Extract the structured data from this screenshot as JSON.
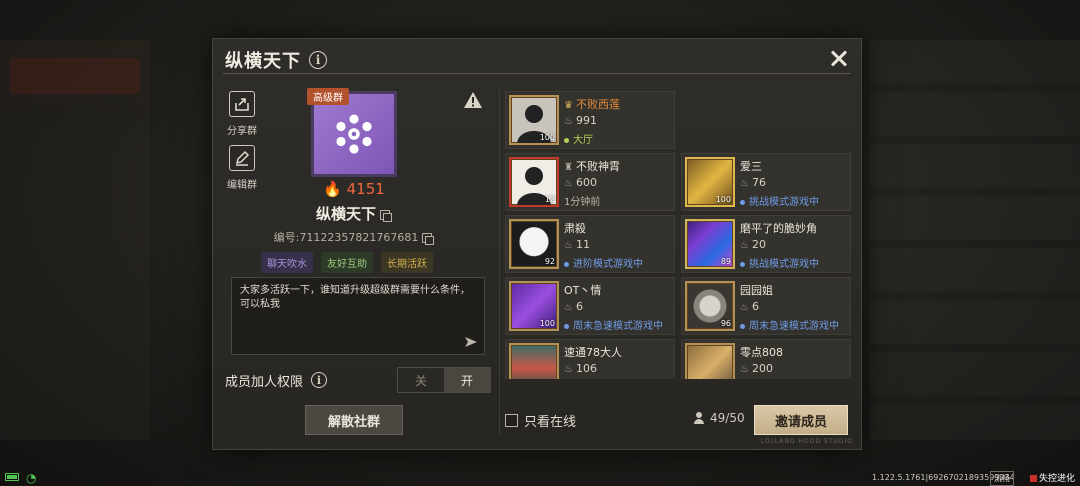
{
  "dialog": {
    "title": "纵横天下",
    "info_icon_label": "i",
    "close_icon": "close-icon"
  },
  "left_panel": {
    "share_label": "分享群",
    "edit_label": "编辑群",
    "badge": "高级群",
    "heat": "4151",
    "group_name": "纵横天下",
    "group_id": "编号:71122357821767681",
    "tags": [
      "聊天吹水",
      "友好互助",
      "长期活跃"
    ],
    "announcement": "大家多活跃一下，谁知道升级超级群需要什么条件，可以私我",
    "permission_label": "成员加人权限",
    "toggle_off": "关",
    "toggle_on": "开",
    "toggle_state": "开",
    "disband_label": "解散社群"
  },
  "members": [
    {
      "name": "不败西莲",
      "heat": "991",
      "status": "大厅",
      "status_color": "#b7d35a",
      "level": "100",
      "leader": true,
      "avatar": "silhouette"
    },
    {
      "name": "不败神霄",
      "heat": "600",
      "status": "1分钟前",
      "status_color": "",
      "level": "12",
      "leader": false,
      "avatar": "silhouette-red"
    },
    {
      "name": "爱三",
      "heat": "76",
      "status": "挑战模式游戏中",
      "status_color": "#6f9be8",
      "level": "100",
      "leader": false,
      "avatar": "gold-frame"
    },
    {
      "name": "肃殺",
      "heat": "11",
      "status": "进阶模式游戏中",
      "status_color": "#6f9be8",
      "level": "92",
      "leader": false,
      "avatar": "anime"
    },
    {
      "name": "磨平了的脆妙角",
      "heat": "20",
      "status": "挑战模式游戏中",
      "status_color": "#6f9be8",
      "level": "89",
      "leader": false,
      "avatar": "purple"
    },
    {
      "name": "OT丶情",
      "heat": "6",
      "status": "周末急速模式游戏中",
      "status_color": "#6f9be8",
      "level": "100",
      "leader": false,
      "avatar": "purple2"
    },
    {
      "name": "园园姐",
      "heat": "6",
      "status": "周末急速模式游戏中",
      "status_color": "#6f9be8",
      "level": "96",
      "leader": false,
      "avatar": "gear"
    },
    {
      "name": "速通78大人",
      "heat": "106",
      "status": "",
      "status_color": "",
      "level": "",
      "leader": false,
      "avatar": "robot"
    },
    {
      "name": "零点808",
      "heat": "200",
      "status": "",
      "status_color": "",
      "level": "",
      "leader": false,
      "avatar": "gold2"
    }
  ],
  "footer": {
    "online_only_label": "只看在线",
    "member_count": "49/50",
    "invite_label": "邀请成员",
    "brand_mark": "LOLLAND HOOD STUDIO"
  },
  "statusbar": {
    "version": "1.122.5.1761|69267021893599234",
    "chip_fluent": "流畅",
    "logo": "失控进化"
  },
  "colors": {
    "heat_orange": "#f0683a",
    "leader_orange": "#e28b3a",
    "online_green": "#b7d35a",
    "in_game_blue": "#6f9be8"
  }
}
